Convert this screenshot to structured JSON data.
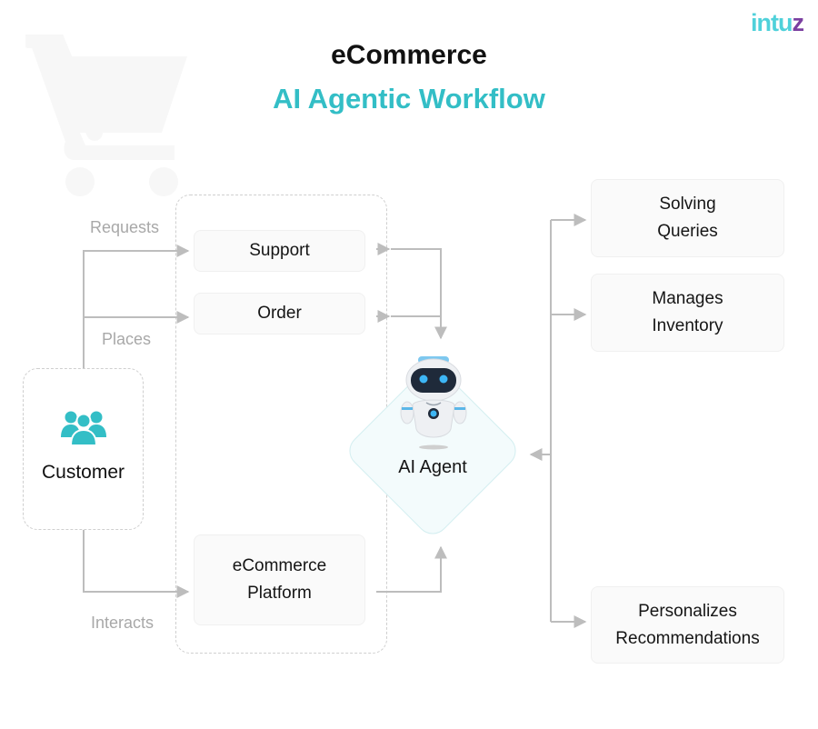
{
  "brand": {
    "logo_main": "intu",
    "logo_accent": "z",
    "colors": {
      "accent": "#33bec6",
      "logo": "#4fd1da",
      "logo_accent": "#7b3fa0",
      "connector": "#bdbdbd",
      "label": "#a8a8a8"
    }
  },
  "header": {
    "title": "eCommerce",
    "subtitle": "AI Agentic Workflow"
  },
  "decor": {
    "background_icon": "shopping-cart-icon"
  },
  "nodes": {
    "customer": {
      "label": "Customer",
      "icon": "users-group-icon"
    },
    "support": {
      "label": "Support"
    },
    "order": {
      "label": "Order"
    },
    "platform": {
      "line1": "eCommerce",
      "line2": "Platform"
    },
    "agent": {
      "label": "AI Agent",
      "icon": "robot-icon"
    }
  },
  "edge_labels": {
    "requests": "Requests",
    "places": "Places",
    "interacts": "Interacts"
  },
  "outputs": [
    {
      "line1": "Solving",
      "line2": "Queries"
    },
    {
      "line1": "Manages",
      "line2": "Inventory"
    },
    {
      "line1": "Personalizes",
      "line2": "Recommendations"
    }
  ],
  "edges": [
    {
      "from": "Customer",
      "to": "Support",
      "label": "Requests"
    },
    {
      "from": "Customer",
      "to": "Order",
      "label": "Places"
    },
    {
      "from": "Customer",
      "to": "eCommerce Platform",
      "label": "Interacts"
    },
    {
      "from": "Support",
      "to": "AI Agent"
    },
    {
      "from": "Order",
      "to": "AI Agent"
    },
    {
      "from": "eCommerce Platform",
      "to": "AI Agent"
    },
    {
      "from": "AI Agent",
      "to": "Solving Queries"
    },
    {
      "from": "AI Agent",
      "to": "Manages Inventory"
    },
    {
      "from": "AI Agent",
      "to": "Personalizes Recommendations"
    }
  ]
}
